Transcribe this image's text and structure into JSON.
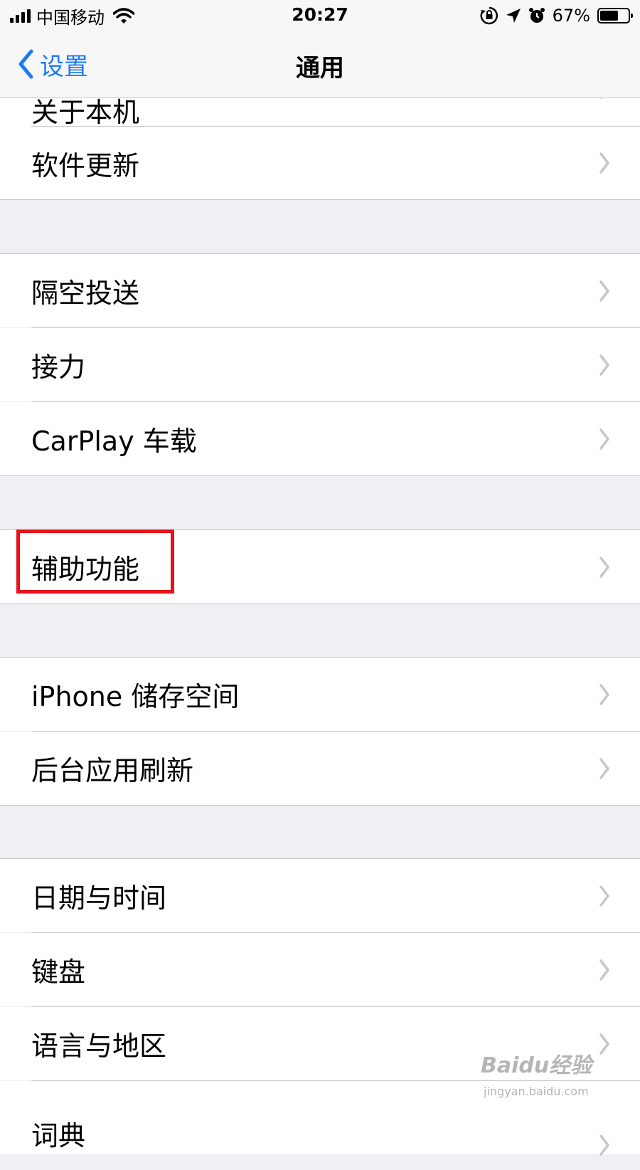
{
  "status_bar": {
    "carrier": "中国移动",
    "time": "20:27",
    "battery_percent": "67%",
    "battery_level": 0.67,
    "icons": [
      "cellular-signal-icon",
      "wifi-icon",
      "orientation-lock-icon",
      "location-arrow-icon",
      "alarm-icon",
      "battery-icon"
    ]
  },
  "nav": {
    "back_label": "设置",
    "title": "通用"
  },
  "groups": {
    "group1": {
      "partial_label": "关于本机",
      "items": [
        {
          "label": "软件更新"
        }
      ]
    },
    "group2": {
      "items": [
        {
          "label": "隔空投送"
        },
        {
          "label": "接力"
        },
        {
          "label": "CarPlay 车载"
        }
      ]
    },
    "group3": {
      "items": [
        {
          "label": "辅助功能"
        }
      ]
    },
    "group4": {
      "items": [
        {
          "label": "iPhone 储存空间"
        },
        {
          "label": "后台应用刷新"
        }
      ]
    },
    "group5": {
      "items": [
        {
          "label": "日期与时间"
        },
        {
          "label": "键盘"
        },
        {
          "label": "语言与地区"
        }
      ],
      "partial_label": "词典"
    }
  },
  "watermark": {
    "main": "Baidu经验",
    "sub": "jingyan.baidu.com"
  },
  "colors": {
    "accent": "#1a7cf5",
    "highlight": "#e8101a",
    "group_background": "#efeff4",
    "separator": "#c8c7cc"
  }
}
